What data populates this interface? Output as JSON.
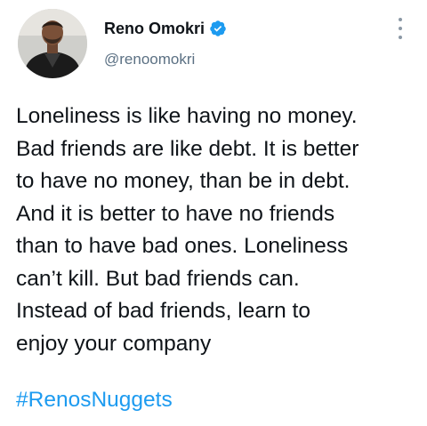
{
  "author": {
    "name": "Reno Omokri",
    "handle": "@renoomokri",
    "verified": true,
    "verified_color": "#1d9bf0"
  },
  "tweet": {
    "lines": [
      "Loneliness is like having no money.",
      "Bad friends are like debt. It is better",
      "to have no money, than be in debt.",
      "And it is better to have no friends",
      "than to have bad ones. Loneliness",
      "can’t kill. But bad friends can.",
      "Instead of bad friends, learn to",
      "enjoy your company"
    ],
    "hashtag": "#RenosNuggets"
  },
  "icons": {
    "avatar": "profile-photo",
    "verified": "verified-badge-icon",
    "more": "more-options-icon"
  },
  "colors": {
    "text": "#0f1419",
    "secondary": "#5b7083",
    "link": "#1d9bf0"
  }
}
